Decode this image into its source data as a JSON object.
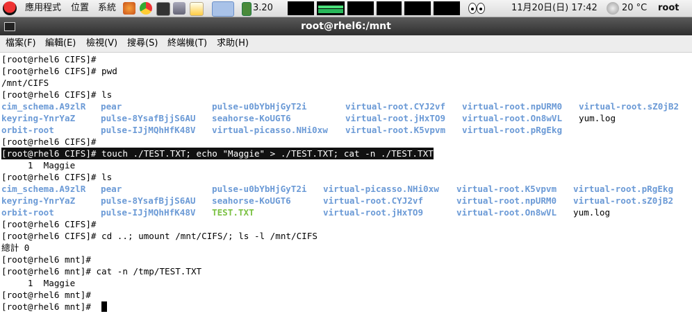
{
  "panel": {
    "menu_applications": "應用程式",
    "menu_places": "位置",
    "menu_system": "系統",
    "cpu_freq": "3.20",
    "datetime": "11月20日(日) 17:42",
    "weather": "20 °C",
    "user": "root"
  },
  "window": {
    "title": "root@rhel6:/mnt"
  },
  "menubar": {
    "file": "檔案(F)",
    "edit": "編輯(E)",
    "view": "檢視(V)",
    "search": "搜尋(S)",
    "terminal": "終端機(T)",
    "help": "求助(H)"
  },
  "terminal": {
    "l0": "[root@rhel6 CIFS]#",
    "l1": "[root@rhel6 CIFS]# pwd",
    "l2": "/mnt/CIFS",
    "l3": "[root@rhel6 CIFS]# ls",
    "ls1": [
      [
        "cim_schema.A9zlR",
        "pear",
        "pulse-u0bYbHjGyT2i",
        "virtual-root.CYJ2vf",
        "virtual-root.npURM0",
        "virtual-root.sZ0jB2"
      ],
      [
        "keyring-YnrYaZ",
        "pulse-8YsafBjjS6AU",
        "seahorse-KoUGT6",
        "virtual-root.jHxTO9",
        "virtual-root.On8wVL",
        "yum.log"
      ],
      [
        "orbit-root",
        "pulse-IJjMQhHfK48V",
        "virtual-picasso.NHi0xw",
        "virtual-root.K5vpvm",
        "virtual-root.pRgEkg",
        ""
      ]
    ],
    "l7": "[root@rhel6 CIFS]#",
    "l8": "[root@rhel6 CIFS]# touch ./TEST.TXT; echo \"Maggie\" > ./TEST.TXT; cat -n ./TEST.TXT",
    "l9": "     1  Maggie",
    "l10": "[root@rhel6 CIFS]# ls",
    "ls2": [
      [
        "cim_schema.A9zlR",
        "pear",
        "pulse-u0bYbHjGyT2i",
        "virtual-picasso.NHi0xw",
        "virtual-root.K5vpvm",
        "virtual-root.pRgEkg"
      ],
      [
        "keyring-YnrYaZ",
        "pulse-8YsafBjjS6AU",
        "seahorse-KoUGT6",
        "virtual-root.CYJ2vf",
        "virtual-root.npURM0",
        "virtual-root.sZ0jB2"
      ],
      [
        "orbit-root",
        "pulse-IJjMQhHfK48V",
        "TEST.TXT",
        "virtual-root.jHxTO9",
        "virtual-root.On8wVL",
        "yum.log"
      ]
    ],
    "l14": "[root@rhel6 CIFS]#",
    "l15": "[root@rhel6 CIFS]# cd ..; umount /mnt/CIFS/; ls -l /mnt/CIFS",
    "l16": "總計 0",
    "l17": "[root@rhel6 mnt]#",
    "l18": "[root@rhel6 mnt]# cat -n /tmp/TEST.TXT",
    "l19": "     1  Maggie",
    "l20": "[root@rhel6 mnt]#",
    "l21": "[root@rhel6 mnt]# "
  },
  "colors": {
    "directory": "#6b9ad6",
    "executable": "#7ac142",
    "selection": "#111111"
  }
}
